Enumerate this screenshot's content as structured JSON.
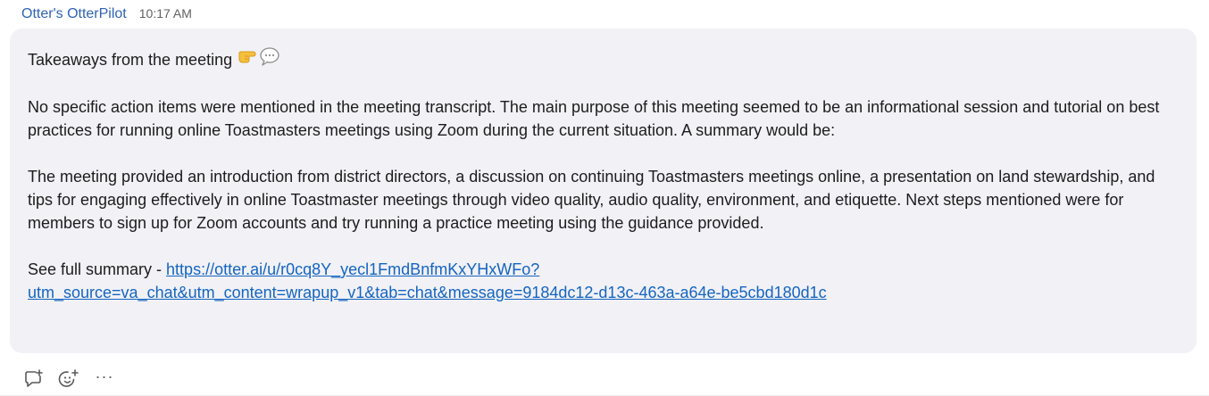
{
  "message": {
    "sender": "Otter's OtterPilot",
    "time": "10:17 AM",
    "title": "Takeaways from the meeting",
    "paragraph1": "No specific action items were mentioned in the meeting transcript. The main purpose of this meeting seemed to be an informational session and tutorial on best practices for running online Toastmasters meetings using Zoom during the current situation. A summary would be:",
    "paragraph2": "The meeting provided an introduction from district directors, a discussion on continuing Toastmasters meetings online, a presentation on land stewardship, and tips for engaging effectively in online Toastmaster meetings through video quality, audio quality, environment, and etiquette. Next steps mentioned were for members to sign up for Zoom accounts and try running a practice meeting using the guidance provided.",
    "summary_prefix": "See full summary - ",
    "summary_link_line1": "https://otter.ai/u/r0cq8Y_yecl1FmdBnfmKxYHxWFo?",
    "summary_link_line2": "utm_source=va_chat&utm_content=wrapup_v1&tab=chat&message=9184dc12-d13c-463a-a64e-be5cbd180d1c"
  },
  "actions": {
    "more_label": "···"
  },
  "icons": {
    "emoji_pointing": "backhand-index-pointing-right-icon",
    "emoji_speech": "speech-balloon-icon",
    "reply": "reply-thread-icon",
    "reaction": "add-reaction-icon"
  },
  "colors": {
    "sender": "#2f63b4",
    "link": "#1565c0",
    "bubble": "#f1f1f6"
  }
}
